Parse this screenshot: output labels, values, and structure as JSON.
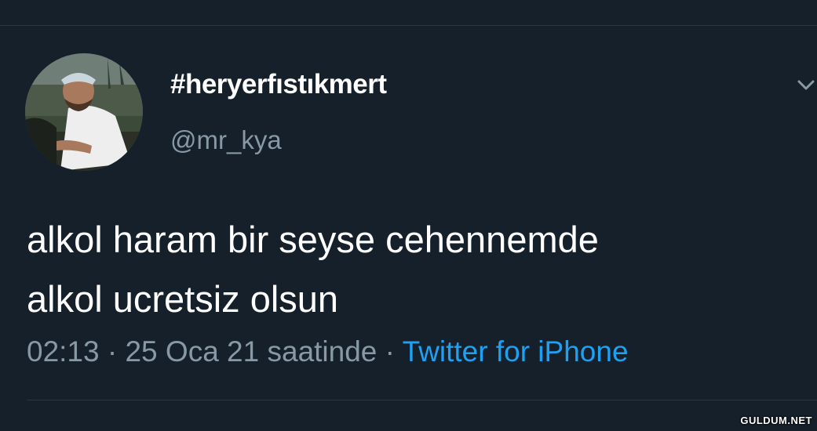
{
  "tweet": {
    "display_name": "#heryerfıstıkmert",
    "handle": "@mr_kya",
    "text_line1": "alkol haram bir seyse cehennemde",
    "text_line2": "alkol ucretsiz olsun",
    "time": "02:13",
    "date": "25 Oca 21 saatinde",
    "separator": " · ",
    "source": "Twitter for iPhone"
  },
  "icons": {
    "menu": "chevron-down-icon",
    "avatar": "profile-photo"
  },
  "watermark": "GULDUM.NET",
  "colors": {
    "background": "#15202b",
    "primary_text": "#ffffff",
    "secondary_text": "#8899a6",
    "link": "#1da1f2",
    "divider": "#2b3844"
  }
}
